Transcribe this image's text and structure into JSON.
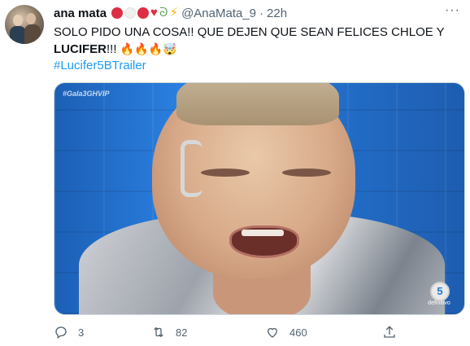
{
  "tweet": {
    "display_name": "ana mata",
    "handle": "@AnaMata_9",
    "separator": "·",
    "time": "22h",
    "text_part1": "SOLO PIDO UNA COSA!! QUE DEJEN QUE SEAN FELICES CHLOE Y ",
    "text_bold": "LUCIFER",
    "text_part2": "!!! ",
    "hashtag": "#Lucifer5BTrailer",
    "media_watermark": "#Gala3GHVIP",
    "media_logo_text": "definitivo",
    "media_logo_letter": "5",
    "replies": "3",
    "retweets": "82",
    "likes": "460"
  },
  "icons": {
    "more": "more-options-icon",
    "reply": "reply-icon",
    "retweet": "retweet-icon",
    "like": "heart-icon",
    "share": "share-icon"
  },
  "colors": {
    "link": "#1d9bf0",
    "muted": "#536471",
    "text": "#0f1419"
  }
}
